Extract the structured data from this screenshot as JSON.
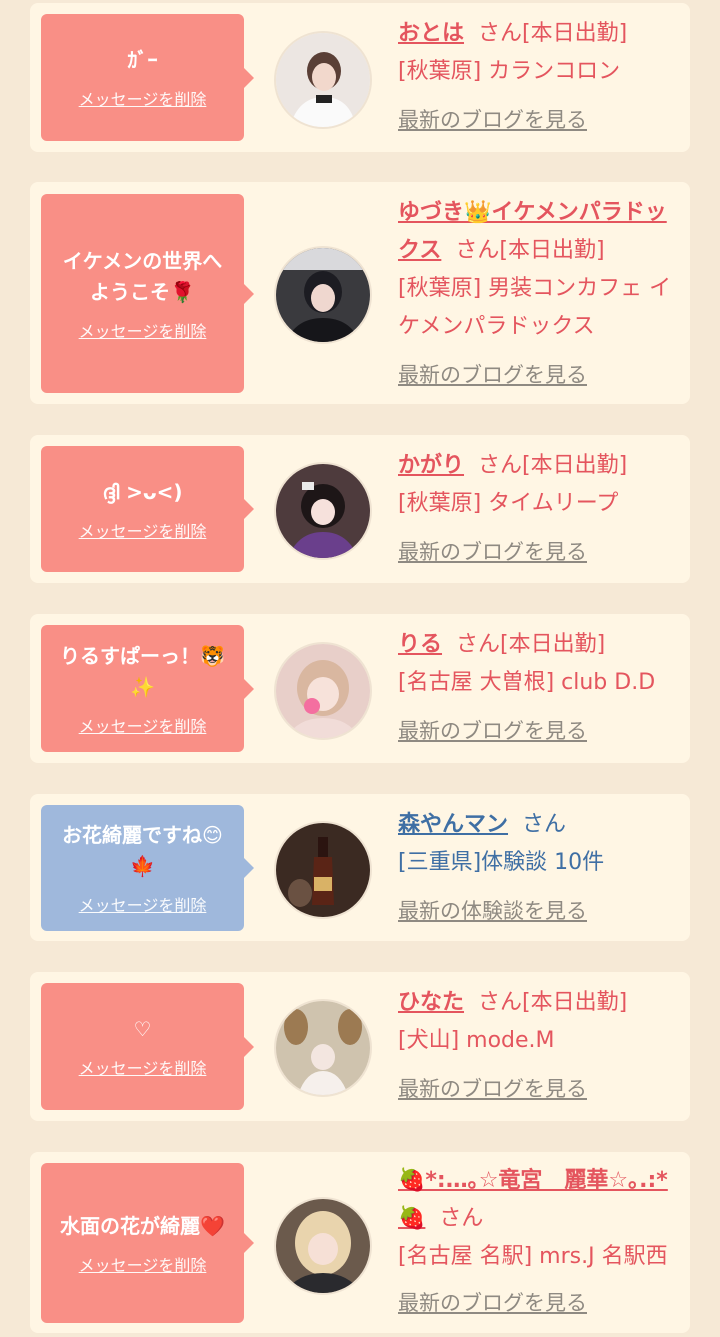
{
  "cards": [
    {
      "bubble_text": "ｶﾞｰ",
      "delete_label": "メッセージを削除",
      "name": "おとは",
      "honorific": "さん",
      "status": "[本日出勤]",
      "shop": "[秋葉原] カランコロン",
      "link": "最新のブログを見る"
    },
    {
      "bubble_text": "イケメンの世界へ\nようこそ🌹",
      "delete_label": "メッセージを削除",
      "name": "ゆづき👑イケメンパラドックス",
      "honorific": "さん",
      "status": "[本日出勤]",
      "shop": "[秋葉原] 男装コンカフェ イケメンパラドックス",
      "link": "最新のブログを見る"
    },
    {
      "bubble_text": "ദ്ദി >ᴗ<)",
      "delete_label": "メッセージを削除",
      "name": "かがり",
      "honorific": "さん",
      "status": "[本日出勤]",
      "shop": "[秋葉原] タイムリープ",
      "link": "最新のブログを見る"
    },
    {
      "bubble_text": "りるすぱーっ！🐯\n✨",
      "delete_label": "メッセージを削除",
      "name": "りる",
      "honorific": "さん",
      "status": "[本日出勤]",
      "shop": "[名古屋 大曽根] club D.D",
      "link": "最新のブログを見る"
    },
    {
      "bubble_text": "お花綺麗ですね😊\n🍁",
      "delete_label": "メッセージを削除",
      "name": "森やんマン",
      "honorific": "さん",
      "status": "",
      "shop": "[三重県]体験談 10件",
      "link": "最新の体験談を見る"
    },
    {
      "bubble_text": "♡",
      "delete_label": "メッセージを削除",
      "name": "ひなた",
      "honorific": "さん",
      "status": "[本日出勤]",
      "shop": "[犬山] mode.M",
      "link": "最新のブログを見る"
    },
    {
      "bubble_text": "水面の花が綺麗❤️",
      "delete_label": "メッセージを削除",
      "name": "🍓*:…｡☆竜宮　麗華☆｡.:*🍓",
      "honorific": "さん",
      "status": "",
      "shop": "[名古屋 名駅] mrs.J 名駅西",
      "link": "最新のブログを見る"
    }
  ],
  "colors": {
    "page_bg": "#f6e9d6",
    "card_bg": "#fff6e4",
    "bubble_pink": "#f98f86",
    "bubble_blue": "#9fb8dc",
    "name_red": "#e4555e",
    "name_blue": "#3f6fa4",
    "link_gray": "#8f8a82"
  }
}
